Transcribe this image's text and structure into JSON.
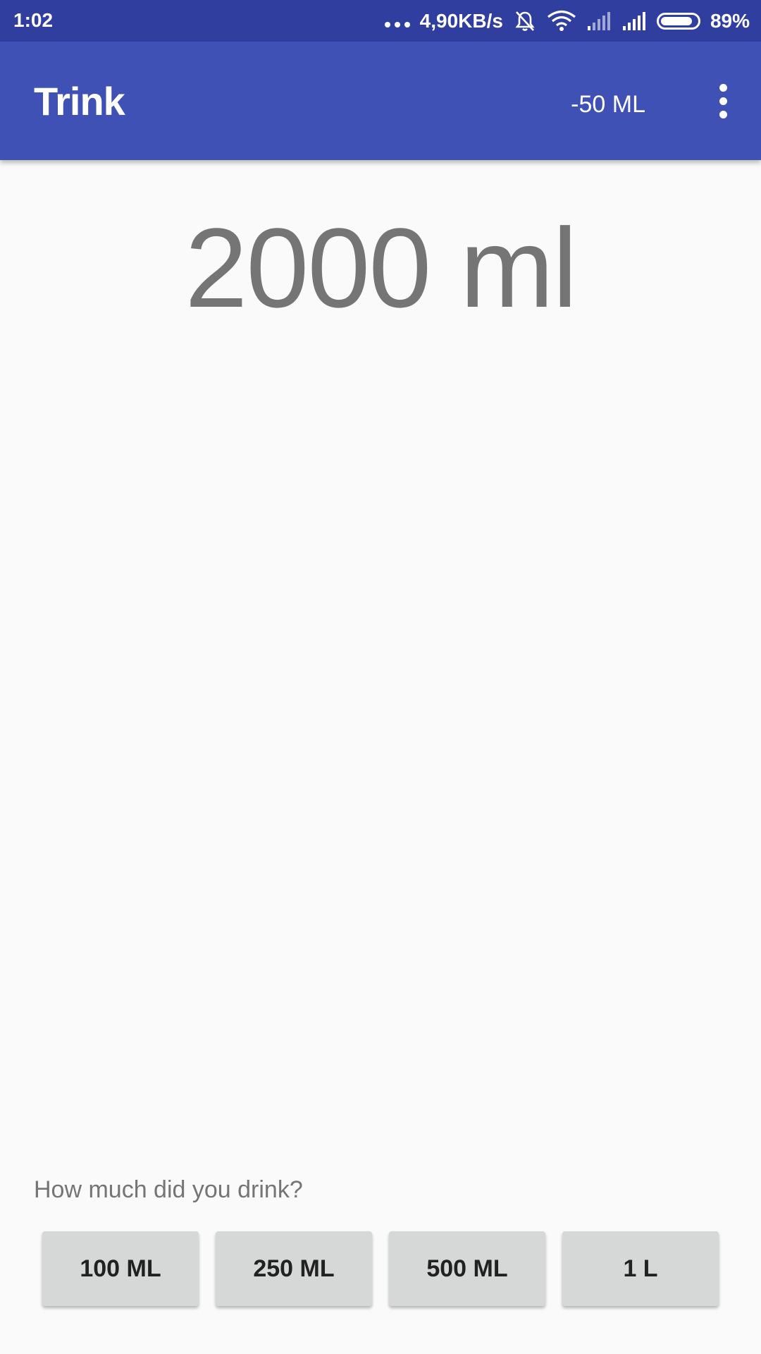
{
  "status_bar": {
    "time": "1:02",
    "network_speed": "4,90KB/s",
    "battery_percent": "89%",
    "battery_level": 0.89,
    "icons": [
      "more-dots-icon",
      "bell-muted-icon",
      "wifi-icon",
      "signal-icon",
      "signal-icon",
      "battery-icon"
    ]
  },
  "app_bar": {
    "title": "Trink",
    "action_label": "-50 ML",
    "overflow_icon": "more-vert-icon"
  },
  "main": {
    "amount": "2000 ml",
    "question": "How much did you drink?",
    "buttons": [
      {
        "label": "100 ML"
      },
      {
        "label": "250 ML"
      },
      {
        "label": "500 ML"
      },
      {
        "label": "1 L"
      }
    ]
  },
  "colors": {
    "status_bar": "#303f9f",
    "app_bar": "#3f51b5",
    "background": "#fafafa",
    "amount_text": "#757575",
    "button_bg": "#d6d7d7"
  }
}
